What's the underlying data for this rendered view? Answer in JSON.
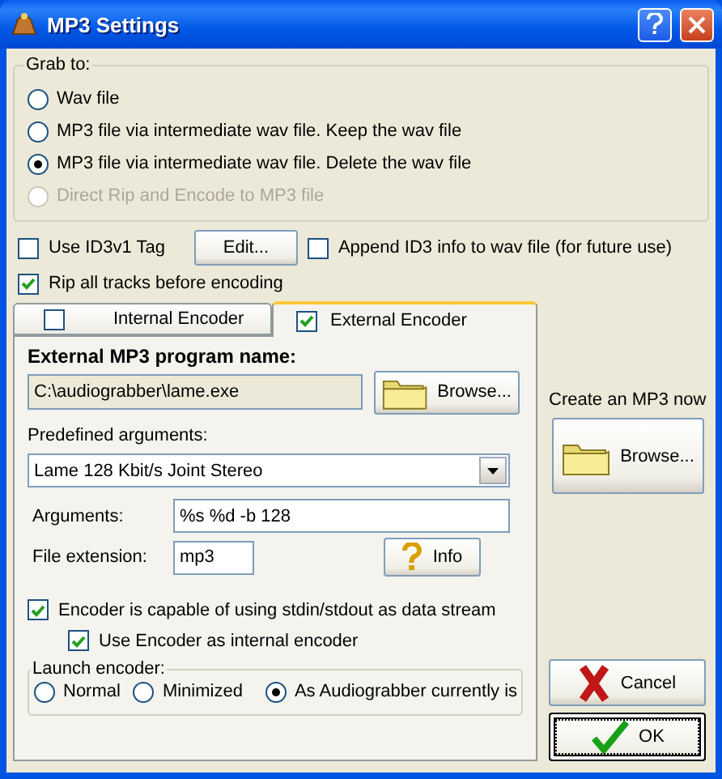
{
  "window": {
    "title": "MP3 Settings"
  },
  "grab_to": {
    "label": "Grab to:",
    "options": [
      {
        "label": "Wav file",
        "selected": false,
        "disabled": false
      },
      {
        "label": "MP3 file via intermediate wav file. Keep the wav file",
        "selected": false,
        "disabled": false
      },
      {
        "label": "MP3 file via intermediate wav file. Delete the wav file",
        "selected": true,
        "disabled": false
      },
      {
        "label": "Direct Rip and Encode to MP3 file",
        "selected": false,
        "disabled": true
      }
    ]
  },
  "id3_tag": {
    "label": "Use ID3v1 Tag",
    "checked": false
  },
  "edit_button": "Edit...",
  "append_id3": {
    "label": "Append ID3 info to wav file (for future use)",
    "checked": false
  },
  "rip_all": {
    "label": "Rip all tracks before encoding",
    "checked": true
  },
  "encoder_tabs": [
    {
      "label": "Internal Encoder",
      "checked": false,
      "selected": false
    },
    {
      "label": "External Encoder",
      "checked": true,
      "selected": true
    }
  ],
  "external": {
    "program_label": "External MP3 program name:",
    "program_path": {
      "value": "C:\\audiograbber\\lame.exe",
      "disabled": true
    },
    "browse_button": "Browse...",
    "predefined_label": "Predefined arguments:",
    "predefined_value": "Lame 128 Kbit/s Joint Stereo",
    "arguments_label": "Arguments:",
    "arguments_value": "%s %d -b 128",
    "extension_label": "File extension:",
    "extension_value": "mp3",
    "info_button": "Info",
    "stdin": {
      "label": "Encoder is capable of using stdin/stdout as data stream",
      "checked": true
    },
    "use_internal": {
      "label": "Use Encoder as internal encoder",
      "checked": true
    },
    "launch": {
      "label": "Launch encoder:",
      "options": [
        {
          "label": "Normal",
          "selected": false
        },
        {
          "label": "Minimized",
          "selected": false
        },
        {
          "label": "As Audiograbber currently is",
          "selected": true
        }
      ]
    }
  },
  "create_now": {
    "label": "Create an MP3 now",
    "button": "Browse..."
  },
  "buttons": [
    {
      "label": "Cancel",
      "kind": "cancel",
      "default": false
    },
    {
      "label": "OK",
      "kind": "ok",
      "default": true
    }
  ]
}
